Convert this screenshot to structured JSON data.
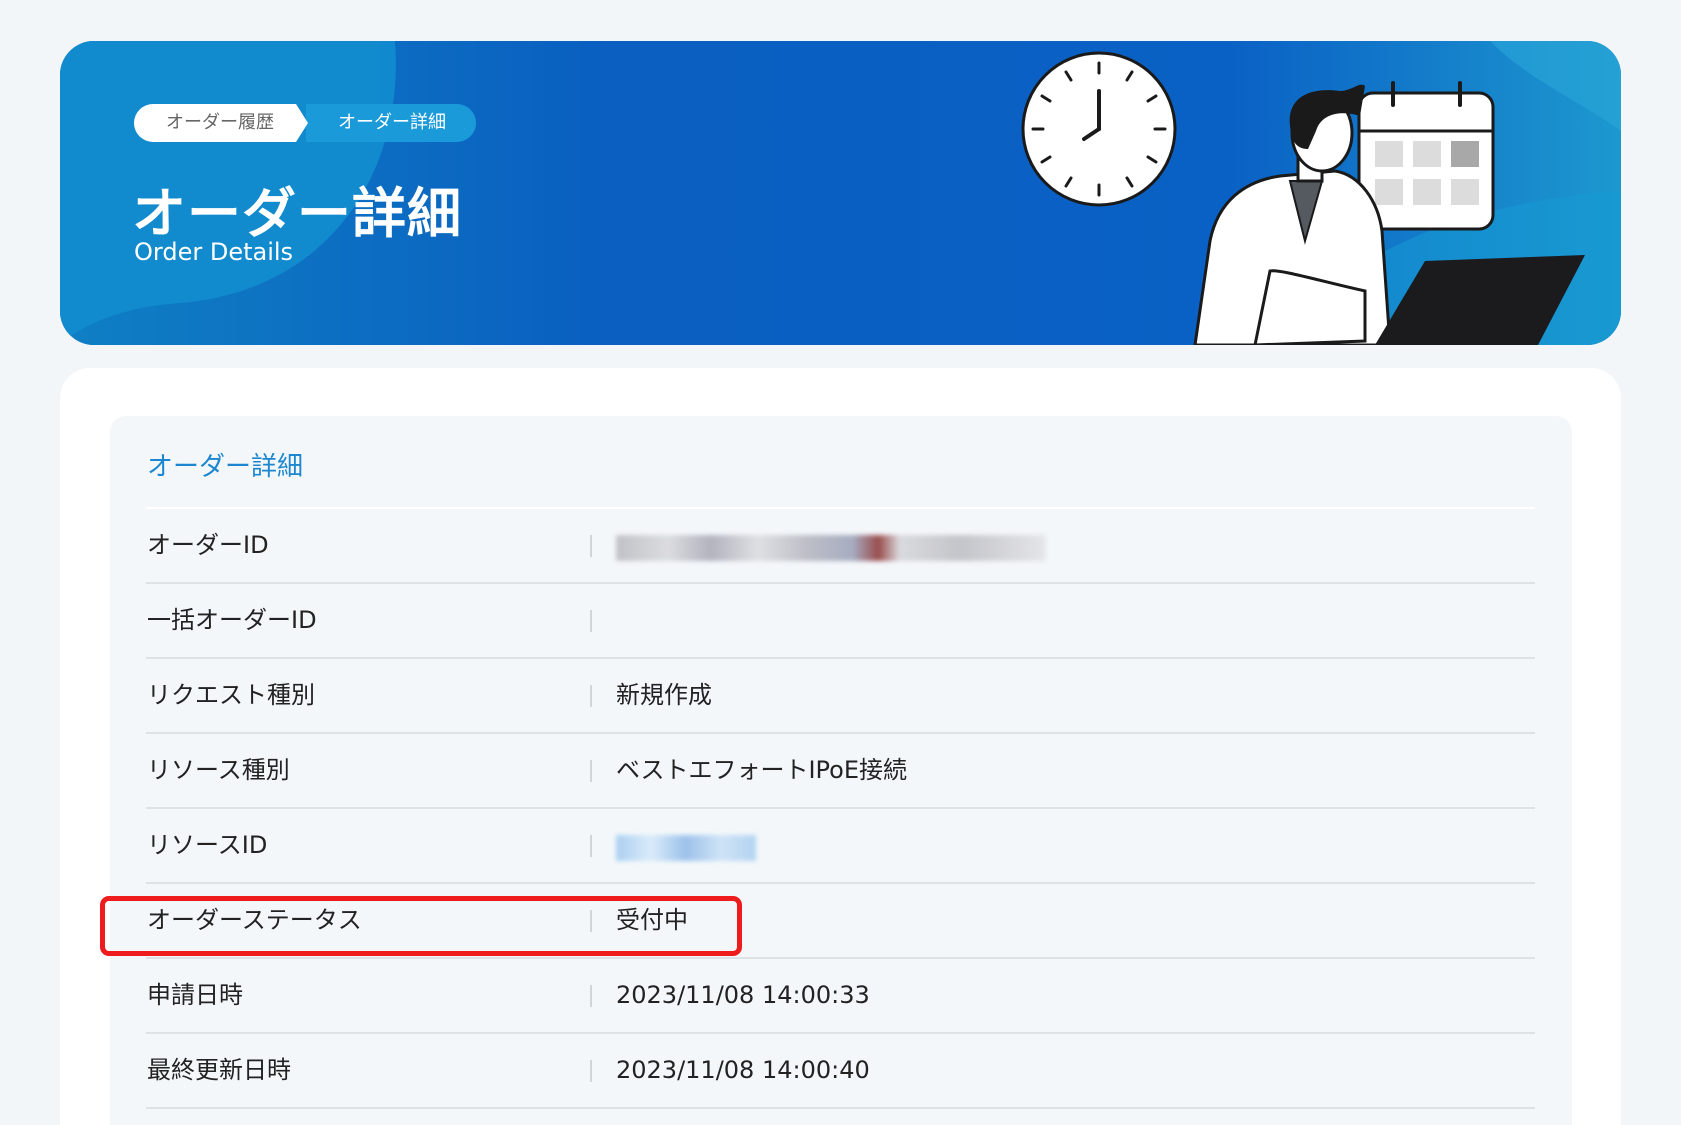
{
  "breadcrumb": {
    "items": [
      {
        "label": "オーダー履歴"
      },
      {
        "label": "オーダー詳細"
      }
    ]
  },
  "hero": {
    "title": "オーダー詳細",
    "subtitle": "Order Details"
  },
  "details": {
    "section_title": "オーダー詳細",
    "rows": [
      {
        "label": "オーダーID",
        "value": ""
      },
      {
        "label": "一括オーダーID",
        "value": ""
      },
      {
        "label": "リクエスト種別",
        "value": "新規作成"
      },
      {
        "label": "リソース種別",
        "value": "ベストエフォートIPoE接続"
      },
      {
        "label": "リソースID",
        "value": ""
      },
      {
        "label": "オーダーステータス",
        "value": "受付中"
      },
      {
        "label": "申請日時",
        "value": "2023/11/08 14:00:33"
      },
      {
        "label": "最終更新日時",
        "value": "2023/11/08 14:00:40"
      }
    ]
  },
  "colors": {
    "banner_blue": "#0b62c4",
    "accent_blue": "#1c87d0",
    "highlight_red": "#ee1c1c"
  },
  "icons": [
    "clock-icon",
    "calendar-icon",
    "laptop-icon"
  ]
}
